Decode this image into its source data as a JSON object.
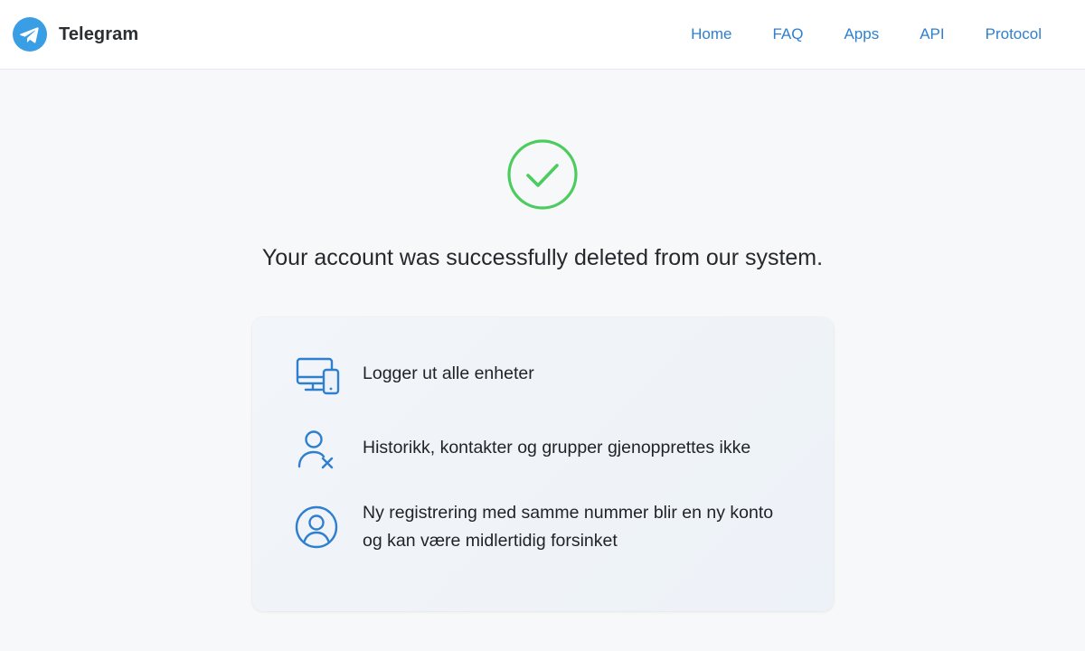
{
  "header": {
    "brand_name": "Telegram",
    "logo_icon": "telegram-logo-icon",
    "nav": [
      {
        "label": "Home"
      },
      {
        "label": "FAQ"
      },
      {
        "label": "Apps"
      },
      {
        "label": "API"
      },
      {
        "label": "Protocol"
      }
    ]
  },
  "main": {
    "status_icon": "check-circle-icon",
    "headline": "Your account was successfully deleted from our system.",
    "info_items": [
      {
        "icon": "devices-icon",
        "text": "Logger ut alle enheter"
      },
      {
        "icon": "user-remove-icon",
        "text": "Historikk, kontakter og grupper gjenopprettes ikke"
      },
      {
        "icon": "user-circle-icon",
        "line1": "Ny registrering med samme nummer blir en ny konto",
        "line2": "og kan være midlertidig forsinket"
      }
    ]
  },
  "colors": {
    "accent": "#2f7fcf",
    "success": "#4ccc5f",
    "logo_blue": "#3a9ee4",
    "card_bg": "#eff3f8"
  }
}
